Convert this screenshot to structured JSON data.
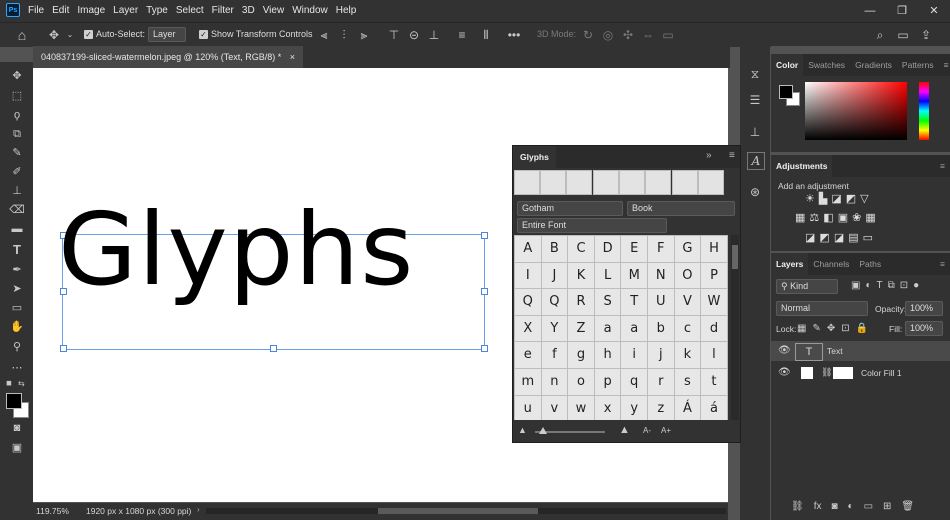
{
  "app": {
    "logo": "Ps"
  },
  "menu": [
    "File",
    "Edit",
    "Image",
    "Layer",
    "Type",
    "Select",
    "Filter",
    "3D",
    "View",
    "Window",
    "Help"
  ],
  "window_controls": [
    "—",
    "❐",
    "✕"
  ],
  "options": {
    "auto_select_label": "Auto-Select:",
    "auto_select_value": "Layer",
    "show_transform_label": "Show Transform Controls",
    "mode_3d_label": "3D Mode:",
    "more": "•••"
  },
  "document": {
    "tab_title": "040837199-sliced-watermelon.jpeg @ 120% (Text, RGB/8) *",
    "close": "×",
    "canvas_text": "Glyphs",
    "zoom": "119.75%",
    "dimensions": "1920 px x 1080 px (300 ppi)"
  },
  "color_panel": {
    "tabs": [
      "Color",
      "Swatches",
      "Gradients",
      "Patterns"
    ],
    "foreground": "#000000",
    "background": "#ffffff"
  },
  "adjustments_panel": {
    "title": "Adjustments",
    "subtitle": "Add an adjustment"
  },
  "layers_panel": {
    "tabs": [
      "Layers",
      "Channels",
      "Paths"
    ],
    "filter_kind": "Kind",
    "blend_mode": "Normal",
    "opacity_label": "Opacity:",
    "opacity_value": "100%",
    "lock_label": "Lock:",
    "fill_label": "Fill:",
    "fill_value": "100%",
    "layers": [
      {
        "name": "Text",
        "type": "text",
        "selected": true
      },
      {
        "name": "Color Fill 1",
        "type": "fill",
        "selected": false
      }
    ]
  },
  "glyphs_panel": {
    "title": "Glyphs",
    "font_family": "Gotham",
    "font_style": "Book",
    "subset": "Entire Font",
    "glyphs": [
      "A",
      "B",
      "C",
      "D",
      "E",
      "F",
      "G",
      "H",
      "I",
      "J",
      "K",
      "L",
      "M",
      "N",
      "O",
      "P",
      "Q",
      "Q",
      "R",
      "S",
      "T",
      "U",
      "V",
      "W",
      "X",
      "Y",
      "Z",
      "a",
      "a",
      "b",
      "c",
      "d",
      "e",
      "f",
      "g",
      "h",
      "i",
      "j",
      "k",
      "l",
      "m",
      "n",
      "o",
      "p",
      "q",
      "r",
      "s",
      "t",
      "u",
      "v",
      "w",
      "x",
      "y",
      "z",
      "Á",
      "á"
    ]
  }
}
